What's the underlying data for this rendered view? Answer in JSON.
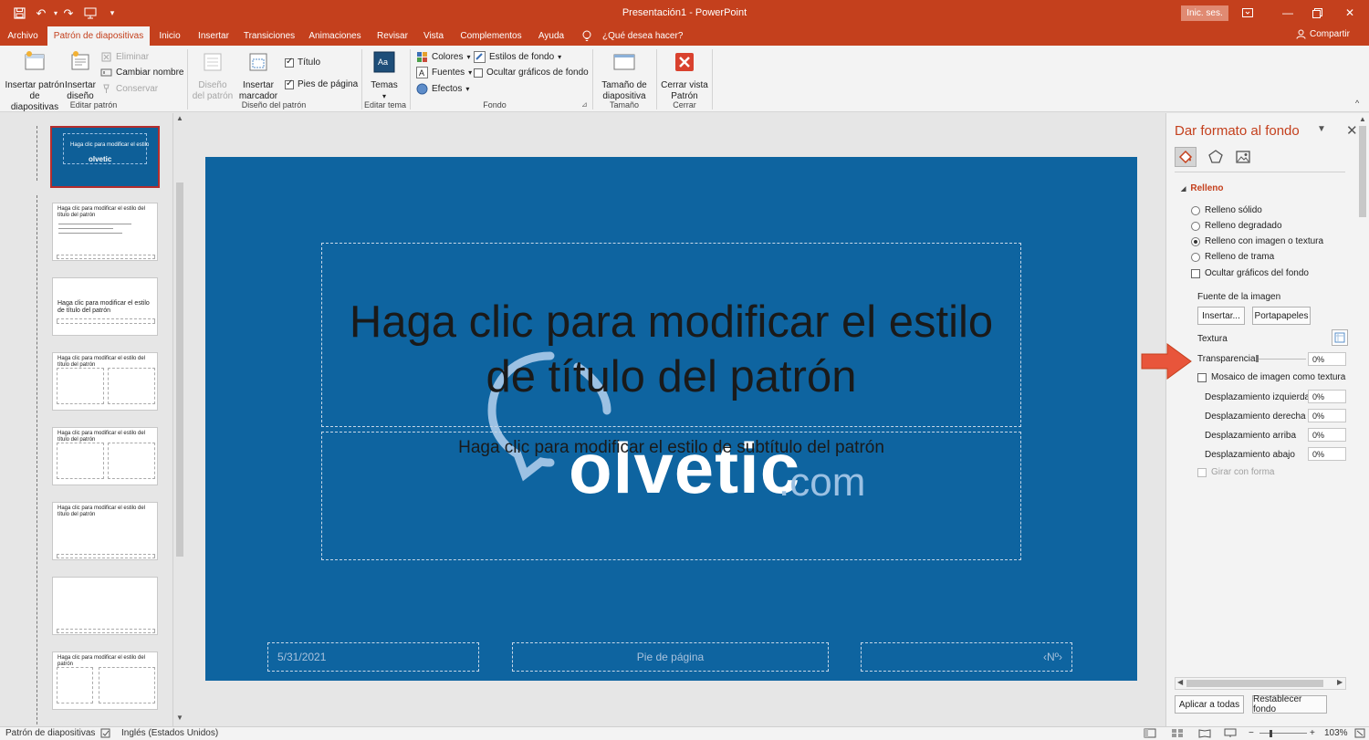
{
  "window": {
    "app_title": "Presentación1 - PowerPoint",
    "signin_label": "Inic. ses.",
    "share_label": "Compartir"
  },
  "tabs": [
    {
      "label": "Archivo"
    },
    {
      "label": "Patrón de diapositivas",
      "active": true
    },
    {
      "label": "Inicio"
    },
    {
      "label": "Insertar"
    },
    {
      "label": "Transiciones"
    },
    {
      "label": "Animaciones"
    },
    {
      "label": "Revisar"
    },
    {
      "label": "Vista"
    },
    {
      "label": "Complementos"
    },
    {
      "label": "Ayuda"
    }
  ],
  "tell_me": "¿Qué desea hacer?",
  "ribbon": {
    "insert_master": "Insertar patrón de diapositivas",
    "insert_layout": "Insertar diseño",
    "delete": "Eliminar",
    "rename": "Cambiar nombre",
    "preserve": "Conservar",
    "group_edit_master": "Editar patrón",
    "master_layout": "Diseño del patrón",
    "insert_placeholder": "Insertar marcador",
    "title_check": "Título",
    "footers_check": "Pies de página",
    "group_master_layout": "Diseño del patrón",
    "themes": "Temas",
    "group_edit_theme": "Editar tema",
    "colors": "Colores",
    "fonts": "Fuentes",
    "effects": "Efectos",
    "bg_styles": "Estilos de fondo",
    "hide_bg_graphics": "Ocultar gráficos de fondo",
    "group_background": "Fondo",
    "slide_size": "Tamaño de diapositiva",
    "group_size": "Tamaño",
    "close_master": "Cerrar vista Patrón",
    "group_close": "Cerrar"
  },
  "thumbnails": {
    "t1": "Haga clic para modificar el estilo",
    "t2": "Haga clic para modificar el estilo del título del patrón",
    "t3": "Haga clic para modificar el estilo de título del patrón",
    "t4": "Haga clic para modificar el estilo del título del patrón",
    "t5": "Haga clic para modificar el estilo del título del patrón",
    "t6": "Haga clic para modificar el estilo del título del patrón",
    "t8": "Haga clic para modificar el estilo del patrón"
  },
  "slide": {
    "title": "Haga clic para modificar el estilo de título del patrón",
    "subtitle": "Haga clic para modificar el estilo de subtítulo del patrón",
    "date": "5/31/2021",
    "footer": "Pie de página",
    "number": "‹Nº›",
    "watermark_main": "olvetic",
    "watermark_suffix": ".com"
  },
  "format_pane": {
    "title": "Dar formato al fondo",
    "section": "Relleno",
    "fill_options": [
      {
        "label": "Relleno sólido",
        "selected": false
      },
      {
        "label": "Relleno degradado",
        "selected": false
      },
      {
        "label": "Relleno con imagen o textura",
        "selected": true
      },
      {
        "label": "Relleno de trama",
        "selected": false
      }
    ],
    "hide_bg_graphics": "Ocultar gráficos del fondo",
    "image_source": "Fuente de la imagen",
    "insert_btn": "Insertar...",
    "clipboard_btn": "Portapapeles",
    "texture": "Textura",
    "transparency": "Transparencia",
    "transparency_value": "0%",
    "tile_as_texture": "Mosaico de imagen como textura",
    "offset_left": "Desplazamiento izquierda",
    "offset_left_value": "0%",
    "offset_right": "Desplazamiento derecha",
    "offset_right_value": "0%",
    "offset_top": "Desplazamiento arriba",
    "offset_top_value": "0%",
    "offset_bottom": "Desplazamiento abajo",
    "offset_bottom_value": "0%",
    "rotate_with_shape": "Girar con forma",
    "apply_all": "Aplicar a todas",
    "reset_bg": "Restablecer fondo"
  },
  "status": {
    "view": "Patrón de diapositivas",
    "language": "Inglés (Estados Unidos)",
    "zoom": "103%"
  },
  "colors": {
    "accent": "#c4401d",
    "slide_bg": "#0e64a0",
    "arrow": "#e8553b"
  }
}
